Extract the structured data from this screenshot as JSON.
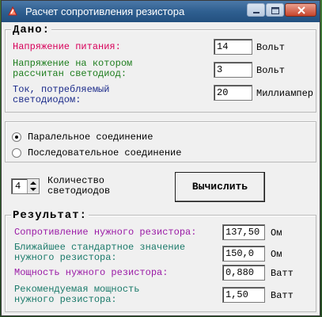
{
  "window": {
    "title": "Расчет сопротивления резистора"
  },
  "input_group": {
    "legend": "Дано:",
    "rows": [
      {
        "label_1": "Напряжение питания:",
        "label_2": "",
        "value": "14",
        "unit": "Вольт",
        "color": "#d8005a"
      },
      {
        "label_1": "Напряжение на котором",
        "label_2": "рассчитан светодиод:",
        "value": "3",
        "unit": "Вольт",
        "color": "#1d7d1d"
      },
      {
        "label_1": "Ток, потребляемый",
        "label_2": "светодиодом:",
        "value": "20",
        "unit": "Миллиампер",
        "color": "#1a2a8a"
      }
    ]
  },
  "connection": {
    "options": [
      "Паралельное соединение",
      "Последовательное соединение"
    ],
    "selected": "Паралельное соединение"
  },
  "count": {
    "value": "4",
    "label_1": "Количество",
    "label_2": "светодиодов"
  },
  "calculate_button": "Вычислить",
  "result_group": {
    "legend": "Результат:",
    "rows": [
      {
        "label_1": "Сопротивление нужного резистора:",
        "label_2": "",
        "value": "137,50",
        "unit": "Ом",
        "color": "#9a1aa6"
      },
      {
        "label_1": "Ближайшее стандартное значение",
        "label_2": "нужного резистора:",
        "value": "150,0",
        "unit": "Ом",
        "color": "#1a7a6a"
      },
      {
        "label_1": "Мощность нужного резистора:",
        "label_2": "",
        "value": "0,880",
        "unit": "Ватт",
        "color": "#9a1aa6"
      },
      {
        "label_1": "Рекомендуемая мощность",
        "label_2": "нужного резистора:",
        "value": "1,50",
        "unit": "Ватт",
        "color": "#1a7a6a"
      }
    ]
  }
}
